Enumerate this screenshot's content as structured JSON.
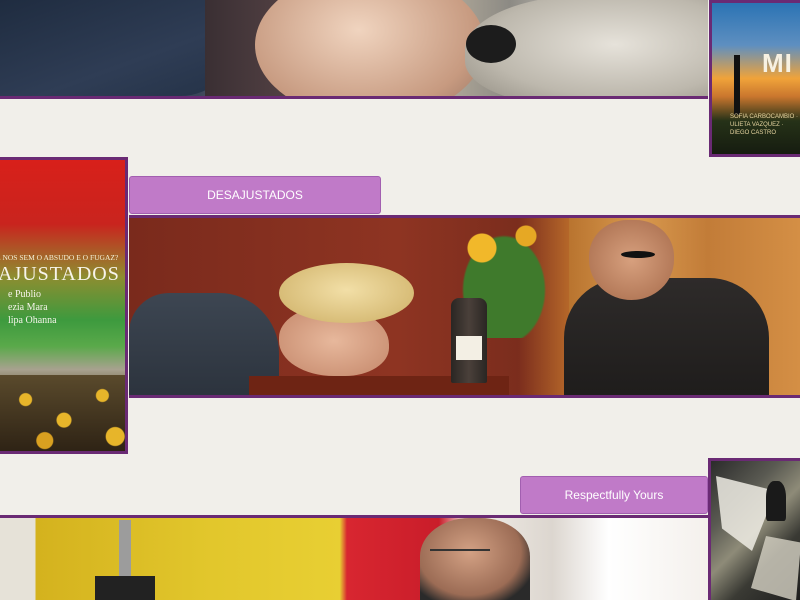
{
  "rows": [
    {
      "image_label": "Dog and person banner"
    },
    {
      "button_label": "DESAJUSTADOS"
    },
    {
      "button_label": "Respectfully Yours"
    }
  ],
  "posters": {
    "top_right": {
      "title": "MI",
      "credits": "SOFIA CARBOCAMBIO · ULIETA VAZQUEZ · DIEGO CASTRO"
    },
    "middle_left": {
      "tagline": "E NOS SEM O ABSUDO E O FUGAZ?",
      "title": "AJUSTADOS",
      "cast": [
        "e Publio",
        "ezia Mara",
        "lipa Ohanna"
      ]
    }
  },
  "colors": {
    "accent_border": "#6a2a74",
    "button_bg": "#c07ac8",
    "page_bg": "#f1efea"
  }
}
